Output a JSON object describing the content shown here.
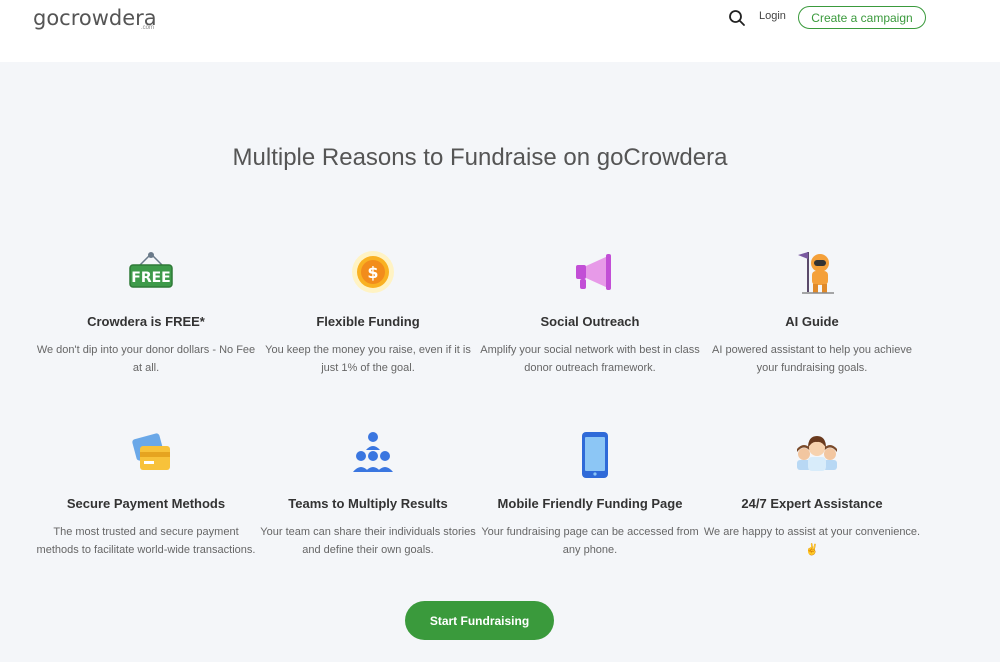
{
  "header": {
    "logo_text": "gocrowdera",
    "logo_sub": ".com",
    "login_label": "Login",
    "create_label": "Create a campaign"
  },
  "main": {
    "title": "Multiple Reasons to Fundraise on goCrowdera",
    "features": [
      {
        "title": "Crowdera is FREE*",
        "desc": "We don't dip into your donor dollars - No Fee at all.",
        "icon": "free-sign-icon",
        "icon_text": "FREE"
      },
      {
        "title": "Flexible Funding",
        "desc": "You keep the money you raise, even if it is just 1% of the goal.",
        "icon": "dollar-coin-icon",
        "icon_text": "$"
      },
      {
        "title": "Social Outreach",
        "desc": "Amplify your social network with best in class donor outreach framework.",
        "icon": "megaphone-icon"
      },
      {
        "title": "AI Guide",
        "desc": "AI powered assistant to help you achieve your fundraising goals.",
        "icon": "astronaut-flag-icon"
      },
      {
        "title": "Secure Payment Methods",
        "desc": "The most trusted and secure payment methods to facilitate world-wide transactions.",
        "icon": "credit-card-icon"
      },
      {
        "title": "Teams to Multiply Results",
        "desc": "Your team can share their individuals stories and define their own goals.",
        "icon": "team-icon"
      },
      {
        "title": "Mobile Friendly Funding Page",
        "desc": "Your fundraising page can be accessed from any phone.",
        "icon": "smartphone-icon"
      },
      {
        "title": "24/7 Expert Assistance",
        "desc": "We are happy to assist at your convenience. ✌",
        "icon": "support-people-icon"
      }
    ],
    "cta_label": "Start Fundraising"
  },
  "colors": {
    "brand_green": "#3a9a3c",
    "background": "#f4f6f9"
  }
}
